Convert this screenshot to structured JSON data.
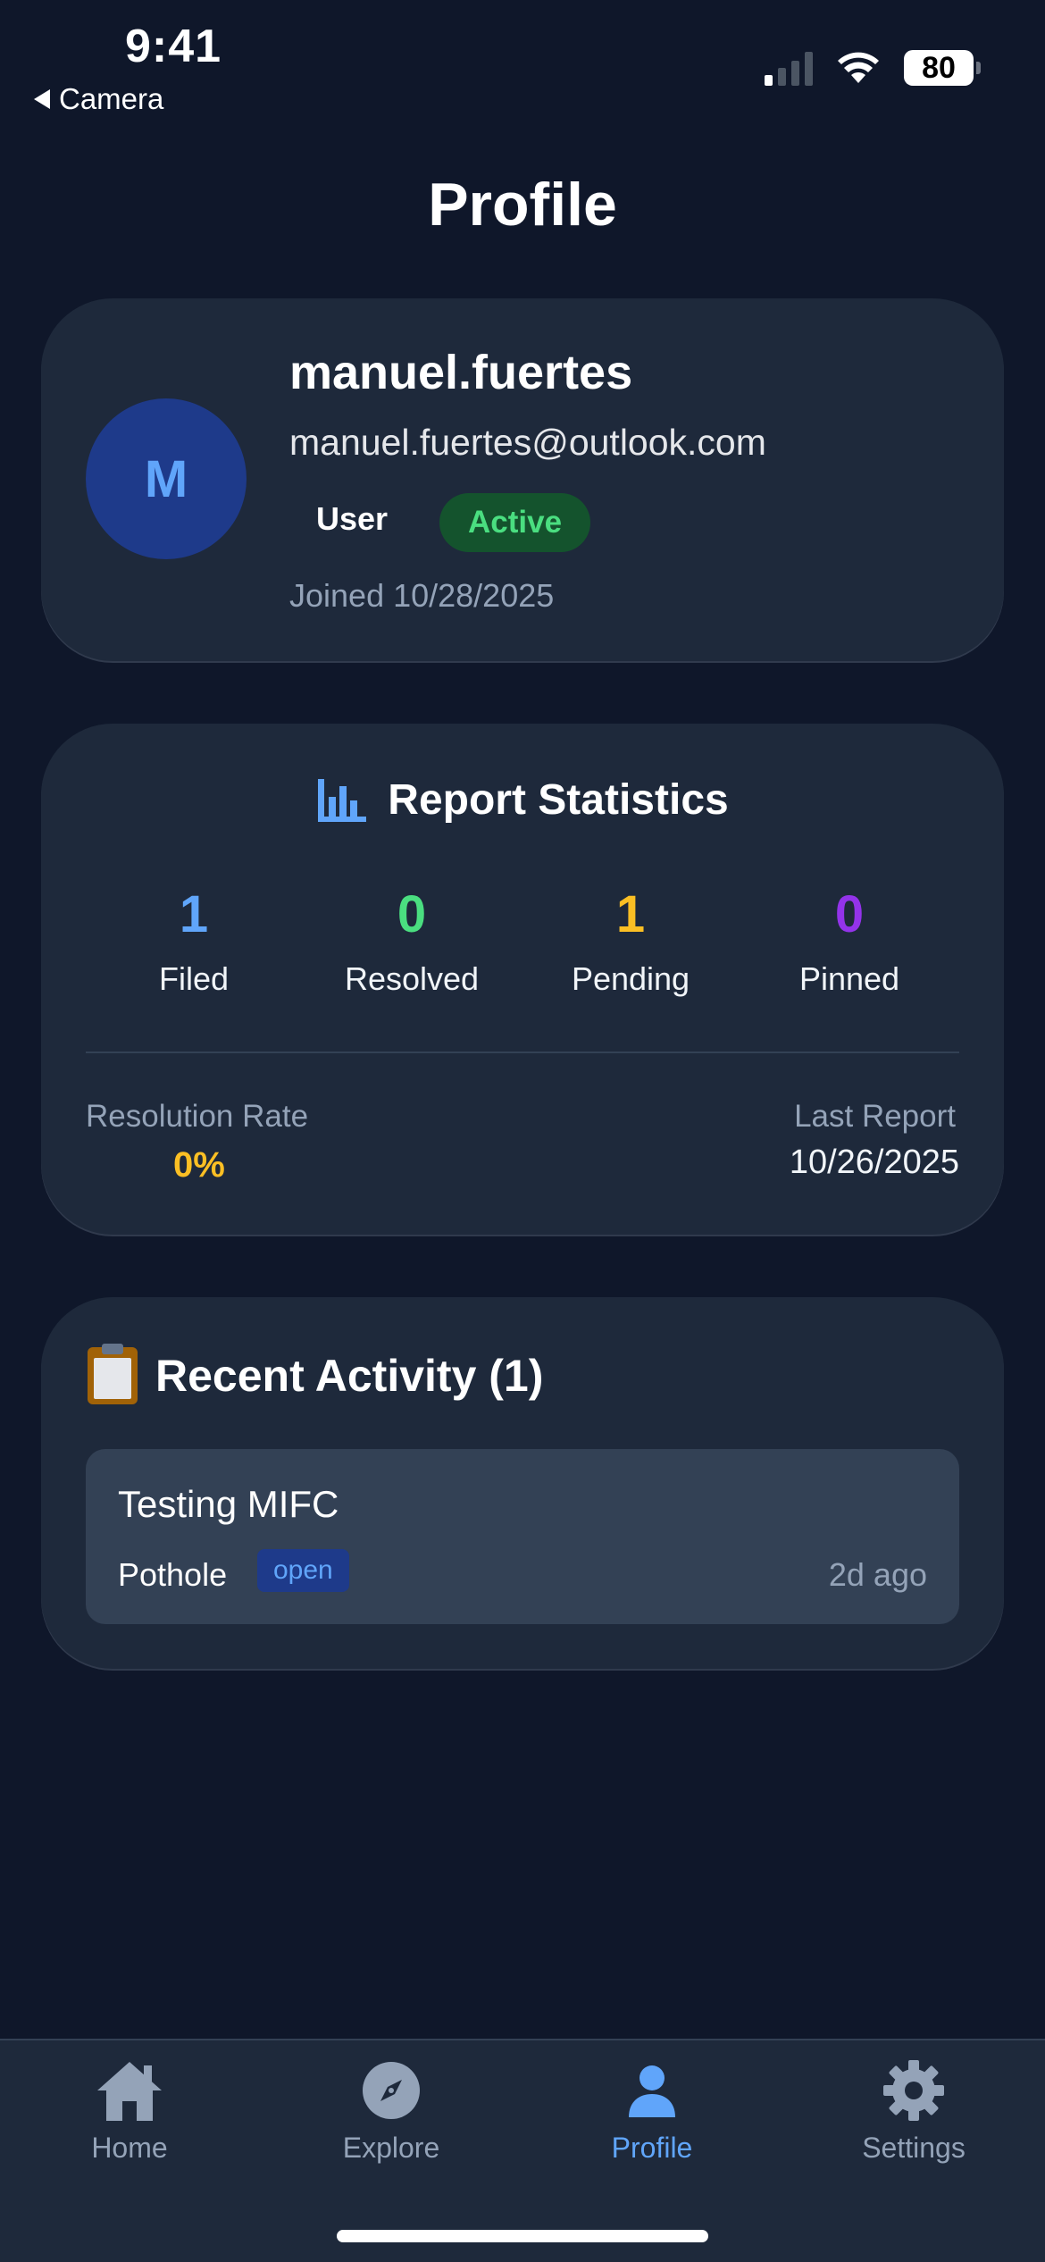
{
  "status_bar": {
    "time": "9:41",
    "back_label": "Camera",
    "battery": "80"
  },
  "page": {
    "title": "Profile"
  },
  "profile": {
    "avatar_initial": "M",
    "username": "manuel.fuertes",
    "email": "manuel.fuertes@outlook.com",
    "role": "User",
    "status": "Active",
    "joined": "Joined 10/28/2025"
  },
  "stats": {
    "title": "Report Statistics",
    "icon": "bar-chart-icon",
    "items": [
      {
        "value": "1",
        "label": "Filed",
        "color": "#60a5fa"
      },
      {
        "value": "0",
        "label": "Resolved",
        "color": "#4ade80"
      },
      {
        "value": "1",
        "label": "Pending",
        "color": "#fbbf24"
      },
      {
        "value": "0",
        "label": "Pinned",
        "color": "#9333ea"
      }
    ],
    "resolution_rate_label": "Resolution Rate",
    "resolution_rate_value": "0%",
    "last_report_label": "Last Report",
    "last_report_value": "10/26/2025"
  },
  "activity": {
    "title": "Recent Activity (1)",
    "icon": "clipboard-icon",
    "items": [
      {
        "title": "Testing MIFC",
        "category": "Pothole",
        "status": "open",
        "time": "2d ago"
      }
    ]
  },
  "tabbar": {
    "tabs": [
      {
        "label": "Home",
        "icon": "home-icon",
        "active": false
      },
      {
        "label": "Explore",
        "icon": "compass-icon",
        "active": false
      },
      {
        "label": "Profile",
        "icon": "person-icon",
        "active": true
      },
      {
        "label": "Settings",
        "icon": "gear-icon",
        "active": false
      }
    ]
  },
  "colors": {
    "background": "#0f172a",
    "card": "#1e293b",
    "accent": "#60a5fa",
    "active_badge_bg": "#14532d",
    "active_badge_text": "#4ade80"
  }
}
